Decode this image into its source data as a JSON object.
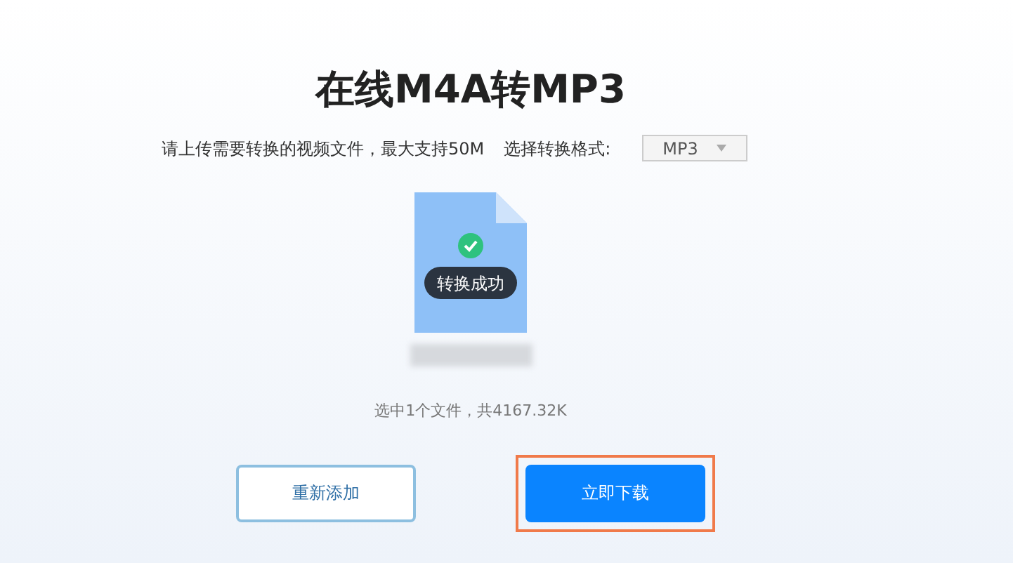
{
  "title": "在线M4A转MP3",
  "upload_hint": "请上传需要转换的视频文件，最大支持50M",
  "format_label": "选择转换格式:",
  "format_select": {
    "value": "MP3"
  },
  "file": {
    "status": "转换成功"
  },
  "summary": "选中1个文件，共4167.32K",
  "buttons": [
    {
      "label": "重新添加",
      "kind": "secondary",
      "highlighted": false
    },
    {
      "label": "立即下载",
      "kind": "primary",
      "highlighted": true
    }
  ]
}
